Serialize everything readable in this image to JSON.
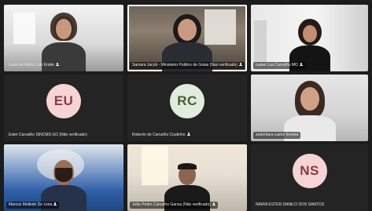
{
  "participants": [
    {
      "name": "Lucia de Maria Luiz Ender",
      "type": "video"
    },
    {
      "name": "Samara Jacob - Ministerio Publico de Goias (Nao verificado)",
      "type": "video",
      "active": true
    },
    {
      "name": "Isabel Lua Carvalho MO",
      "type": "video"
    },
    {
      "name": "Ester Carvalho SINCMS GO (Não verificado)",
      "type": "avatar",
      "initials": "EU",
      "avatar_color": "#f6d3d5"
    },
    {
      "name": "Roberto de Carvalho Coutinho",
      "type": "avatar",
      "initials": "RC",
      "avatar_color": "#e1ecdc"
    },
    {
      "name": "anderliara castro ferreira",
      "type": "video"
    },
    {
      "name": "Marcos Molledo De Lima",
      "type": "video"
    },
    {
      "name": "João Pedro Carvalho Garcia (Não verificado)",
      "type": "video"
    },
    {
      "name": "NAIRA ESTER DANILO DOS SANTOS",
      "type": "avatar",
      "initials": "NS",
      "avatar_color": "#f6d3d5"
    }
  ],
  "mic_icon": "mic-icon"
}
